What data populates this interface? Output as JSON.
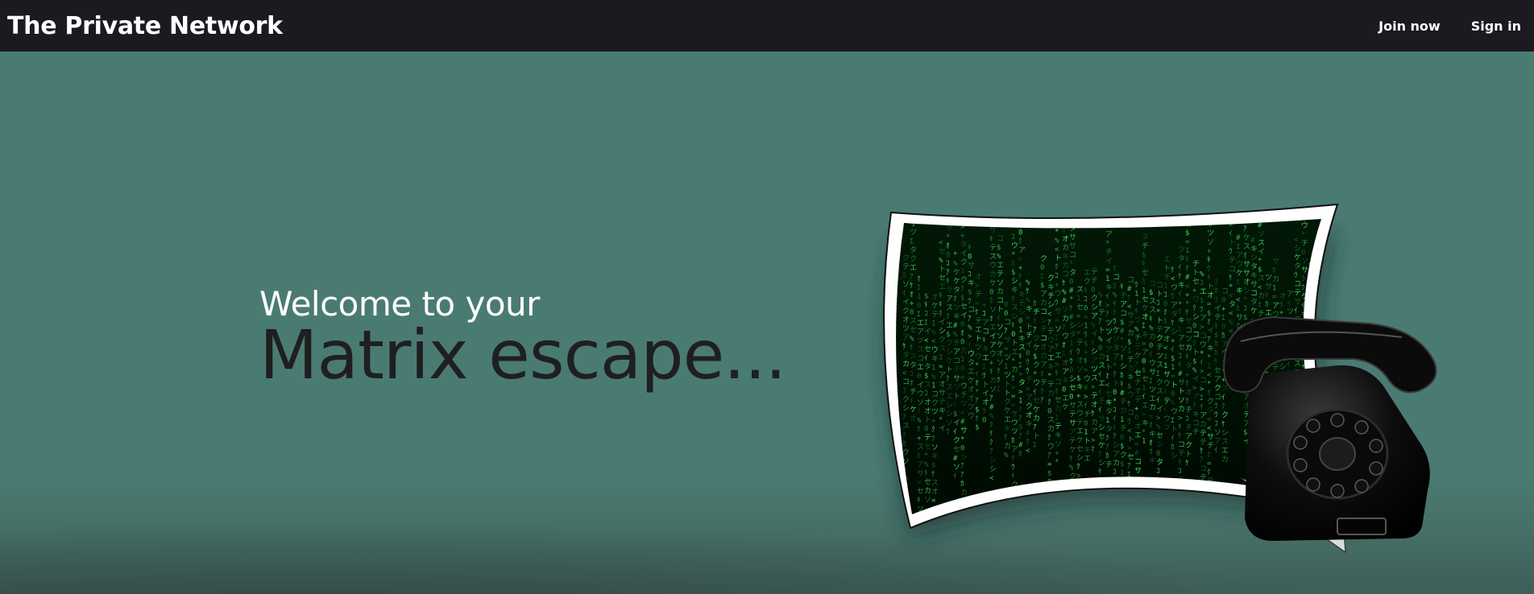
{
  "navbar": {
    "brand": "The Private Network",
    "links": {
      "join_label": "Join now",
      "signin_label": "Sign in"
    },
    "background_color": "#1b1a20"
  },
  "hero": {
    "welcome_text": "Welcome to your",
    "headline_text": "Matrix escape...",
    "background_color": "#4a7b72",
    "artwork": {
      "description_icon": "matrix-screen-with-rotary-phone",
      "code_color": "#3de05a"
    }
  }
}
